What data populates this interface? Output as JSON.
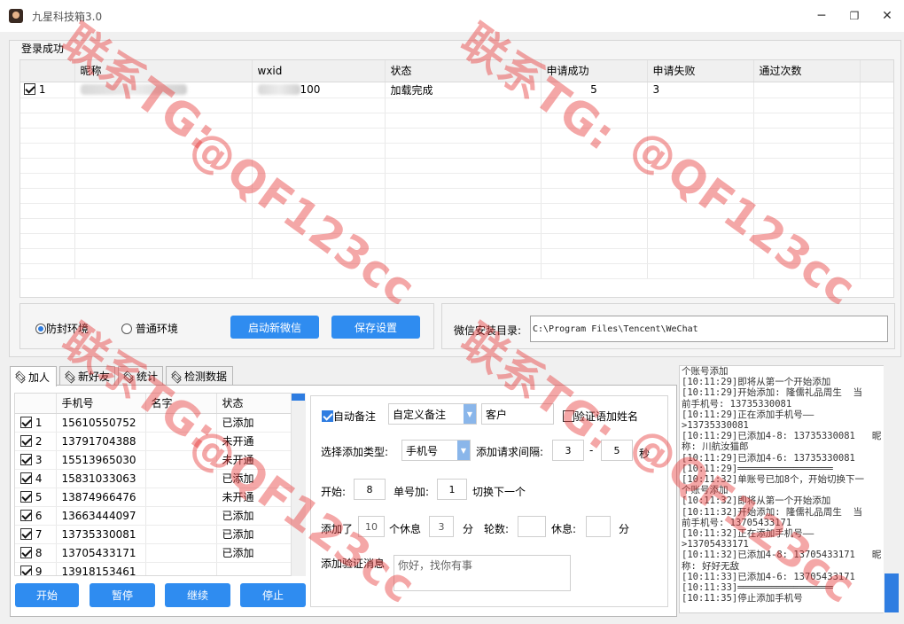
{
  "window": {
    "title": "九星科技箱3.0",
    "controls": {
      "minimize": "─",
      "maximize": "❐",
      "close": "✕"
    }
  },
  "login": {
    "group_label": "登录成功",
    "columns": [
      "",
      "昵称",
      "wxid",
      "状态",
      "申请成功",
      "申请失败",
      "通过次数"
    ],
    "rows": [
      {
        "checked": true,
        "index": "1",
        "nickname": "",
        "wxid": "100",
        "status": "加载完成",
        "success": "5",
        "fail": "3",
        "passed": ""
      }
    ]
  },
  "environment": {
    "options": [
      "防封环境",
      "普通环境"
    ],
    "selected": "防封环境",
    "start_button": "启动新微信",
    "save_button": "保存设置"
  },
  "install_dir": {
    "label": "微信安装目录:",
    "value": "C:\\Program Files\\Tencent\\WeChat"
  },
  "tabs": [
    "加人",
    "新好友",
    "统计",
    "检测数据"
  ],
  "active_tab": "加人",
  "phone_list": {
    "columns": [
      "",
      "手机号",
      "名字",
      "状态"
    ],
    "rows": [
      {
        "checked": true,
        "index": "1",
        "phone": "15610550752",
        "name": "",
        "status": "已添加"
      },
      {
        "checked": true,
        "index": "2",
        "phone": "13791704388",
        "name": "",
        "status": "未开通"
      },
      {
        "checked": true,
        "index": "3",
        "phone": "15513965030",
        "name": "",
        "status": "未开通"
      },
      {
        "checked": true,
        "index": "4",
        "phone": "15831033063",
        "name": "",
        "status": "已添加"
      },
      {
        "checked": true,
        "index": "5",
        "phone": "13874966476",
        "name": "",
        "status": "未开通"
      },
      {
        "checked": true,
        "index": "6",
        "phone": "13663444097",
        "name": "",
        "status": "已添加"
      },
      {
        "checked": true,
        "index": "7",
        "phone": "13735330081",
        "name": "",
        "status": "已添加"
      },
      {
        "checked": true,
        "index": "8",
        "phone": "13705433171",
        "name": "",
        "status": "已添加"
      },
      {
        "checked": true,
        "index": "9",
        "phone": "13918153461",
        "name": "",
        "status": ""
      }
    ]
  },
  "actions": {
    "start": "开始",
    "pause": "暂停",
    "resume": "继续",
    "stop": "停止"
  },
  "settings": {
    "auto_remark_label": "自动备注",
    "auto_remark_checked": true,
    "remark_mode": "自定义备注",
    "remark_text": "客户",
    "verify_name_label": "验证语加姓名",
    "verify_name_checked": false,
    "add_type_label": "选择添加类型:",
    "add_type_value": "手机号",
    "interval_label": "添加请求间隔:",
    "interval_min": "3",
    "interval_dash": "-",
    "interval_max": "5",
    "interval_unit": "秒",
    "start_label": "开始:",
    "start_value": "8",
    "per_account_label": "单号加:",
    "per_account_value": "1",
    "switch_label": "切换下一个",
    "added_label": "添加了",
    "added_value": "10",
    "rest_label": "个休息",
    "rest_value": "3",
    "rest_unit": "分",
    "rounds_label": "轮数:",
    "rounds_value": "",
    "rest2_label": "休息:",
    "rest2_value": "",
    "rest2_unit": "分",
    "verify_msg_label": "添加验证消息",
    "verify_msg_placeholder": "你好，找你有事"
  },
  "log_lines": [
    "个账号添加",
    "[10:11:29]即将从第一个开始添加",
    "[10:11:29]开始添加: 隆儒礼品周生  当",
    "前手机号: 13735330081",
    "[10:11:29]正在添加手机号——",
    ">13735330081",
    "[10:11:29]已添加4-8: 13735330081   昵",
    "称: 川航汝猫郎",
    "[10:11:29]已添加4-6: 13735330081",
    "[10:11:29]═════════════════",
    "[10:11:32]单账号已加8个，开始切换下一",
    "个账号添加",
    "[10:11:32]即将从第一个开始添加",
    "[10:11:32]开始添加: 隆儒礼品周生  当",
    "前手机号: 13705433171",
    "[10:11:32]正在添加手机号——",
    ">13705433171",
    "[10:11:32]已添加4-8: 13705433171   昵",
    "称: 好好无敌",
    "[10:11:33]已添加4-6: 13705433171",
    "[10:11:33]═════════════════",
    "[10:11:35]停止添加手机号"
  ],
  "watermark": {
    "line1": "联系TG:",
    "line2": "@QF123cc",
    "color": "#e63c3c"
  }
}
